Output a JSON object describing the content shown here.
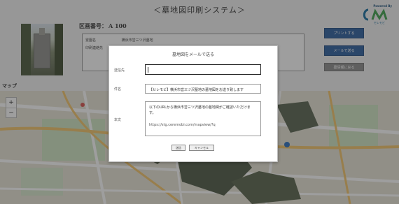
{
  "header": {
    "title": "＜墓地図印刷システム＞",
    "logo_powered": "Powered By",
    "logo_name": "セレモビ"
  },
  "plot": {
    "label": "区画番号：",
    "number": "A 100"
  },
  "info": {
    "rows": [
      {
        "key": "霊園名",
        "value": "横浜市営三ツ沢墓地"
      },
      {
        "key": "印刷連絡先",
        "value": ""
      }
    ]
  },
  "side_buttons": {
    "print": "プリントする",
    "mail": "メールで送る",
    "back": "墓情報に戻る"
  },
  "map": {
    "label": "マップ",
    "zoom_in": "+",
    "zoom_out": "−"
  },
  "modal": {
    "title": "墓地図をメールで送る",
    "to_label": "送信先",
    "to_value": "",
    "subject_label": "件名",
    "subject_value": "【セレモビ】横浜市営三ツ沢墓地の墓地図をお送り致します",
    "body_label": "本文",
    "body_text": "以下のURLから横浜市営三ツ沢墓地の墓地図がご確認いただけます。",
    "body_url": "https://stg.ceremobi.com/mapview/?q",
    "send": "送信",
    "cancel": "キャンセル"
  },
  "colors": {
    "primary_button": "#2d5f9e",
    "secondary_button": "#8c8c8c",
    "overlay": "rgba(40,40,40,0.45)"
  }
}
